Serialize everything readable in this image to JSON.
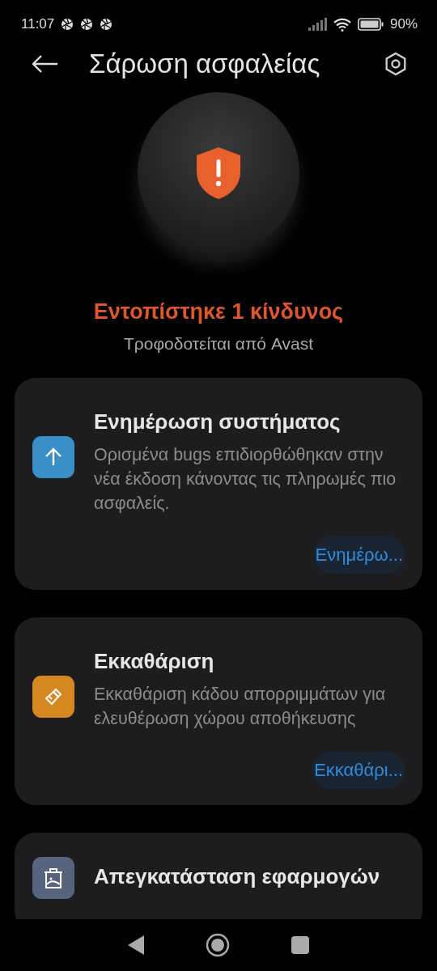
{
  "status_bar": {
    "time": "11:07",
    "battery": "90%"
  },
  "header": {
    "title": "Σάρωση ασφαλείας"
  },
  "scan_result": {
    "headline": "Εντοπίστηκε 1 κίνδυνος",
    "subtitle": "Τροφοδοτείται από Avast"
  },
  "cards": [
    {
      "kind": "update",
      "color": "#3b8fc9",
      "title": "Ενημέρωση συστήματος",
      "description": "Ορισμένα bugs επιδιορθώθηκαν στην νέα έκδοση κάνοντας τις πληρωμές πιο ασφαλείς.",
      "action": "Ενημέρω..."
    },
    {
      "kind": "clean",
      "color": "#d4881f",
      "title": "Εκκαθάριση",
      "description": "Εκκαθάριση κάδου απορριμμάτων για ελευθέρωση χώρου αποθήκευσης",
      "action": "Εκκαθάρι..."
    },
    {
      "kind": "uninstall",
      "color": "#56647e",
      "title": "Απεγκατάσταση εφαρμογών"
    }
  ]
}
